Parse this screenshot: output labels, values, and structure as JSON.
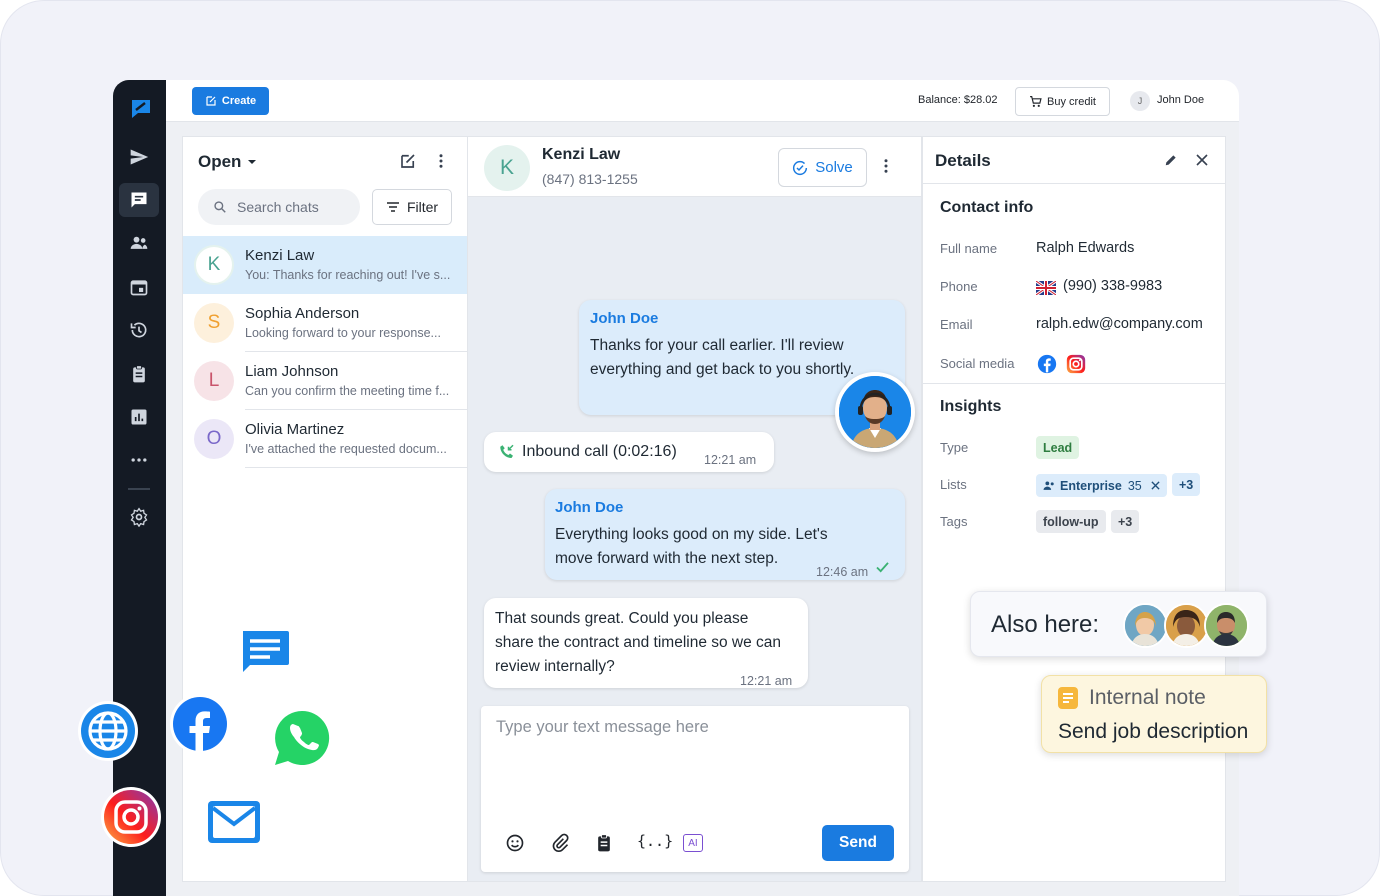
{
  "topbar": {
    "create_label": "Create",
    "balance": "Balance: $28.02",
    "buy_credit_label": "Buy credit",
    "user_initial": "J",
    "user_name": "John Doe"
  },
  "chat_list": {
    "filter_status": "Open",
    "search_placeholder": "Search chats",
    "filter_label": "Filter",
    "items": [
      {
        "initial": "K",
        "name": "Kenzi Law",
        "preview": "You: Thanks for reaching out! I've s...",
        "color": "#4aa391",
        "bg": "#e4f2ee"
      },
      {
        "initial": "S",
        "name": "Sophia Anderson",
        "preview": "Looking forward to your response...",
        "color": "#f0a030",
        "bg": "#fdf0dc"
      },
      {
        "initial": "L",
        "name": "Liam Johnson",
        "preview": "Can you confirm the meeting time f...",
        "color": "#c9546b",
        "bg": "#f7e3e7"
      },
      {
        "initial": "O",
        "name": "Olivia Martinez",
        "preview": "I've attached the requested docum...",
        "color": "#7a68c9",
        "bg": "#ebe7f7"
      }
    ]
  },
  "conversation": {
    "contact_initial": "K",
    "contact_name": "Kenzi Law",
    "contact_phone": "(847) 813-1255",
    "solve_label": "Solve",
    "messages": [
      {
        "sender": "John Doe",
        "text": "Thanks for your call earlier. I'll review everything and get back to you shortly."
      },
      {
        "call": "Inbound call (0:02:16)",
        "time": "12:21 am"
      },
      {
        "sender": "John Doe",
        "text": "Everything looks good on my side. Let's move forward with the next step.",
        "time": "12:46 am"
      },
      {
        "text": "That sounds great. Could you please share the contract and timeline so we can review internally?",
        "time": "12:21 am"
      }
    ],
    "composer_placeholder": "Type your text message here",
    "send_label": "Send",
    "ai_label": "AI",
    "variables_label": "{..}"
  },
  "details": {
    "title": "Details",
    "contact_info_title": "Contact info",
    "full_name_label": "Full name",
    "full_name": "Ralph Edwards",
    "phone_label": "Phone",
    "phone": "(990) 338-9983",
    "email_label": "Email",
    "email": "ralph.edw@company.com",
    "social_label": "Social media",
    "insights_title": "Insights",
    "type_label": "Type",
    "type_value": "Lead",
    "lists_label": "Lists",
    "list_name": "Enterprise",
    "list_count": "35",
    "lists_more": "+3",
    "tags_label": "Tags",
    "tag": "follow-up",
    "tags_more": "+3"
  },
  "overlays": {
    "also_here_label": "Also here:",
    "note_title": "Internal note",
    "note_text": "Send job description"
  },
  "colors": {
    "primary": "#1a7be0",
    "rail": "#141a24",
    "outgoing_bubble": "#dcecfb",
    "lead_chip": "#dff3e2"
  }
}
